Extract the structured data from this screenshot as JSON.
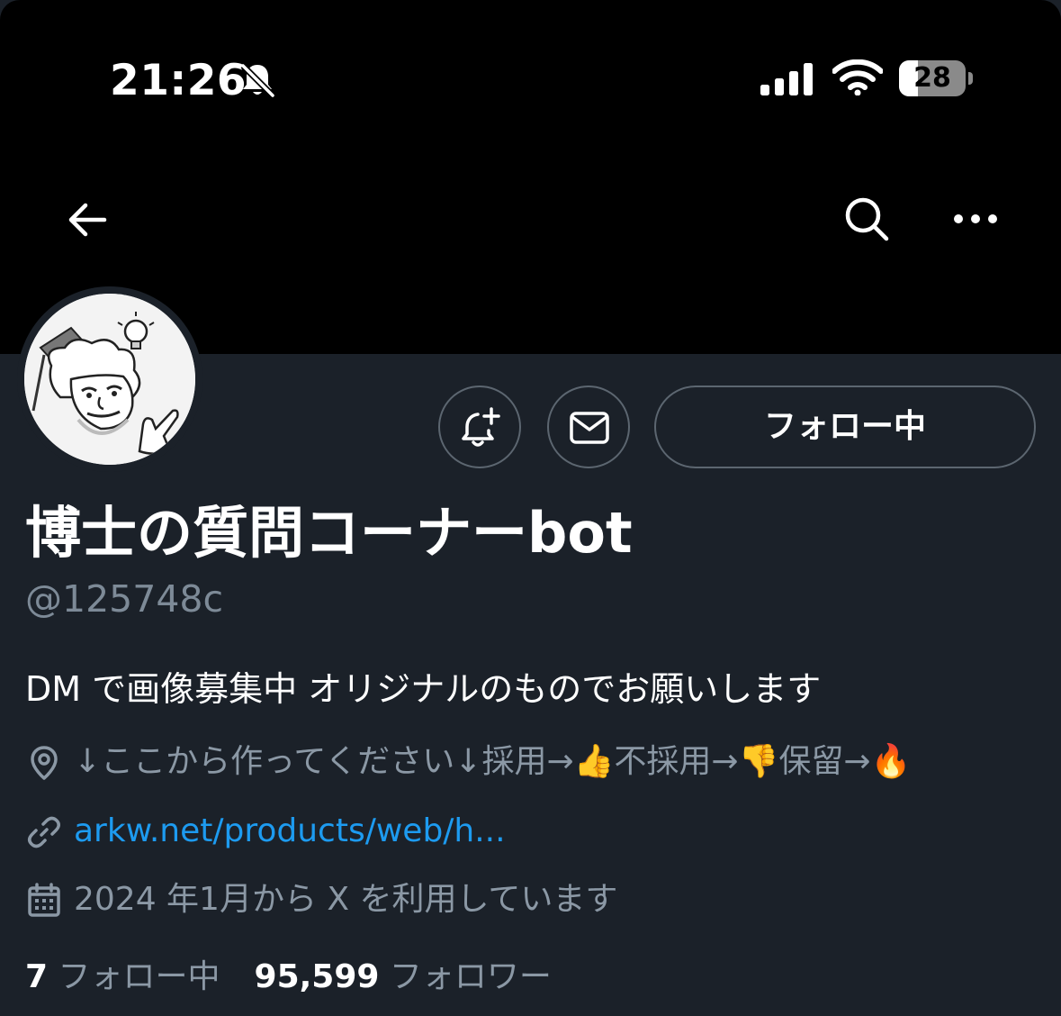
{
  "status_bar": {
    "time": "21:26",
    "battery_level": "28",
    "battery_fraction": 0.28
  },
  "nav": {
    "back_icon": "arrow-left-icon",
    "search_icon": "search-icon",
    "more_icon": "more-horizontal-icon"
  },
  "profile": {
    "display_name": "博士の質問コーナーbot",
    "handle": "@125748c",
    "bio": "DM で画像募集中 オリジナルのものでお願いします",
    "location": "↓ここから作ってください↓採用→👍不採用→👎保留→🔥",
    "url": "arkw.net/products/web/h...",
    "joined": "2024 年1月から X を利用しています",
    "following_count": "7",
    "following_label": "フォロー中",
    "followers_count": "95,599",
    "followers_label": "フォロワー"
  },
  "actions": {
    "notify_icon": "bell-plus-icon",
    "message_icon": "mail-icon",
    "follow_label": "フォロー中"
  },
  "colors": {
    "background": "#1b2129",
    "header": "#000000",
    "link": "#1d9bf0",
    "secondary_text": "#8b98a5",
    "border": "#5c6670"
  }
}
